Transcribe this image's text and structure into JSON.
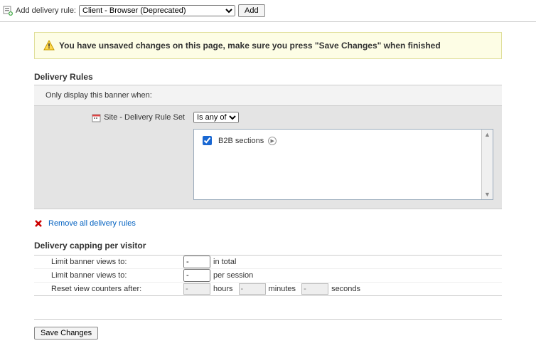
{
  "toolbar": {
    "label": "Add delivery rule:",
    "selected": "Client - Browser (Deprecated)",
    "add_label": "Add"
  },
  "warning": "You have unsaved changes on this page, make sure you press \"Save Changes\" when finished",
  "rules": {
    "title": "Delivery Rules",
    "header": "Only display this banner when:",
    "row_label": "Site - Delivery Rule Set",
    "operator": "Is any of",
    "options": [
      {
        "label": "B2B sections",
        "checked": true
      }
    ],
    "remove_label": "Remove all delivery rules"
  },
  "capping": {
    "title": "Delivery capping per visitor",
    "row1_label": "Limit banner views to:",
    "row1_value": "-",
    "row1_suffix": "in total",
    "row2_label": "Limit banner views to:",
    "row2_value": "-",
    "row2_suffix": "per session",
    "row3_label": "Reset view counters after:",
    "hours_value": "-",
    "hours_suffix": "hours",
    "minutes_value": "-",
    "minutes_suffix": "minutes",
    "seconds_value": "-",
    "seconds_suffix": "seconds"
  },
  "save_label": "Save Changes"
}
